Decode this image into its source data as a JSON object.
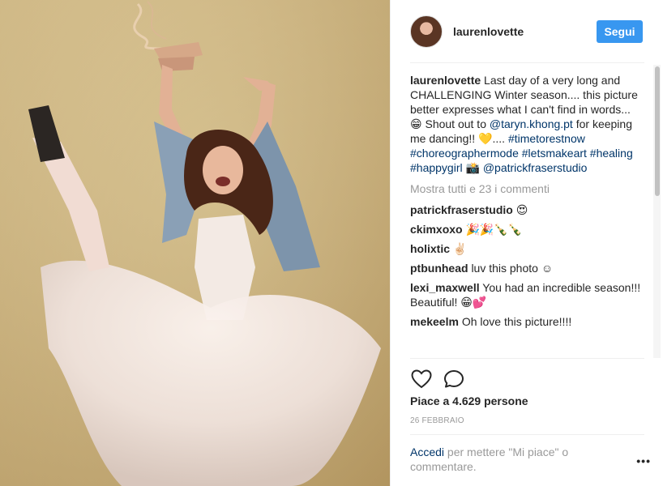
{
  "post": {
    "username": "laurenlovette",
    "follow_label": "Segui",
    "caption": {
      "username": "laurenlovette",
      "text_1": "Last day of a very long and CHALLENGING Winter season.... this picture better expresses what I can't find in words... 😁 Shout out to ",
      "mention_1": "@taryn.khong.pt",
      "text_2": " for keeping me dancing!! 💛.... ",
      "hashtags": "#timetorestnow #choreographermode #letsmakeart #healing #happygirl",
      "text_3": " 📸 ",
      "mention_2": "@patrickfraserstudio"
    },
    "view_all_comments": "Mostra tutti e 23 i commenti",
    "comments": [
      {
        "user": "patrickfraserstudio",
        "text": "😍"
      },
      {
        "user": "ckimxoxo",
        "text": "🎉🎉🍾🍾"
      },
      {
        "user": "holixtic",
        "text": "✌🏻"
      },
      {
        "user": "ptbunhead",
        "text": "luv this photo ☺"
      },
      {
        "user": "lexi_maxwell",
        "text": "You had an incredible season!!! Beautiful! 😁💕"
      },
      {
        "user": "mekeelm",
        "text": "Oh love this picture!!!!"
      }
    ],
    "likes": "Piace a 4.629 persone",
    "date": "26 FEBBRAIO",
    "footer": {
      "login_label": "Accedi",
      "text": " per mettere \"Mi piace\" o commentare."
    },
    "more_options_icon": "ellipsis-icon",
    "icons": {
      "like": "heart-icon",
      "comment": "comment-bubble-icon"
    }
  }
}
